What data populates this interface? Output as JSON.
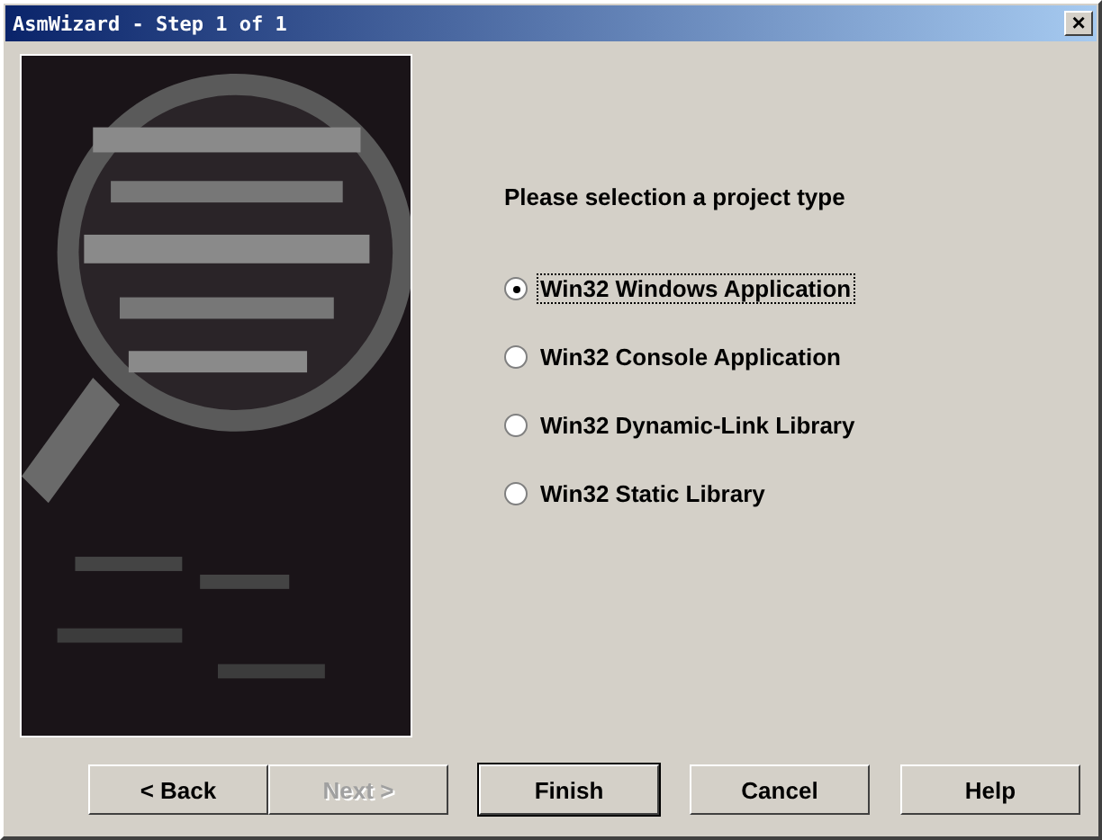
{
  "window": {
    "title": "AsmWizard - Step 1 of 1",
    "close_label": "×"
  },
  "prompt": "Please selection a project type",
  "options": [
    {
      "label": "Win32 Windows Application",
      "selected": true
    },
    {
      "label": "Win32 Console Application",
      "selected": false
    },
    {
      "label": "Win32 Dynamic-Link Library",
      "selected": false
    },
    {
      "label": "Win32 Static Library",
      "selected": false
    }
  ],
  "buttons": [
    {
      "label": "< Back",
      "disabled": false,
      "default": false
    },
    {
      "label": "Next >",
      "disabled": true,
      "default": false
    },
    {
      "label": "Finish",
      "disabled": false,
      "default": true
    },
    {
      "label": "Cancel",
      "disabled": false,
      "default": false
    },
    {
      "label": "Help",
      "disabled": false,
      "default": false
    }
  ]
}
